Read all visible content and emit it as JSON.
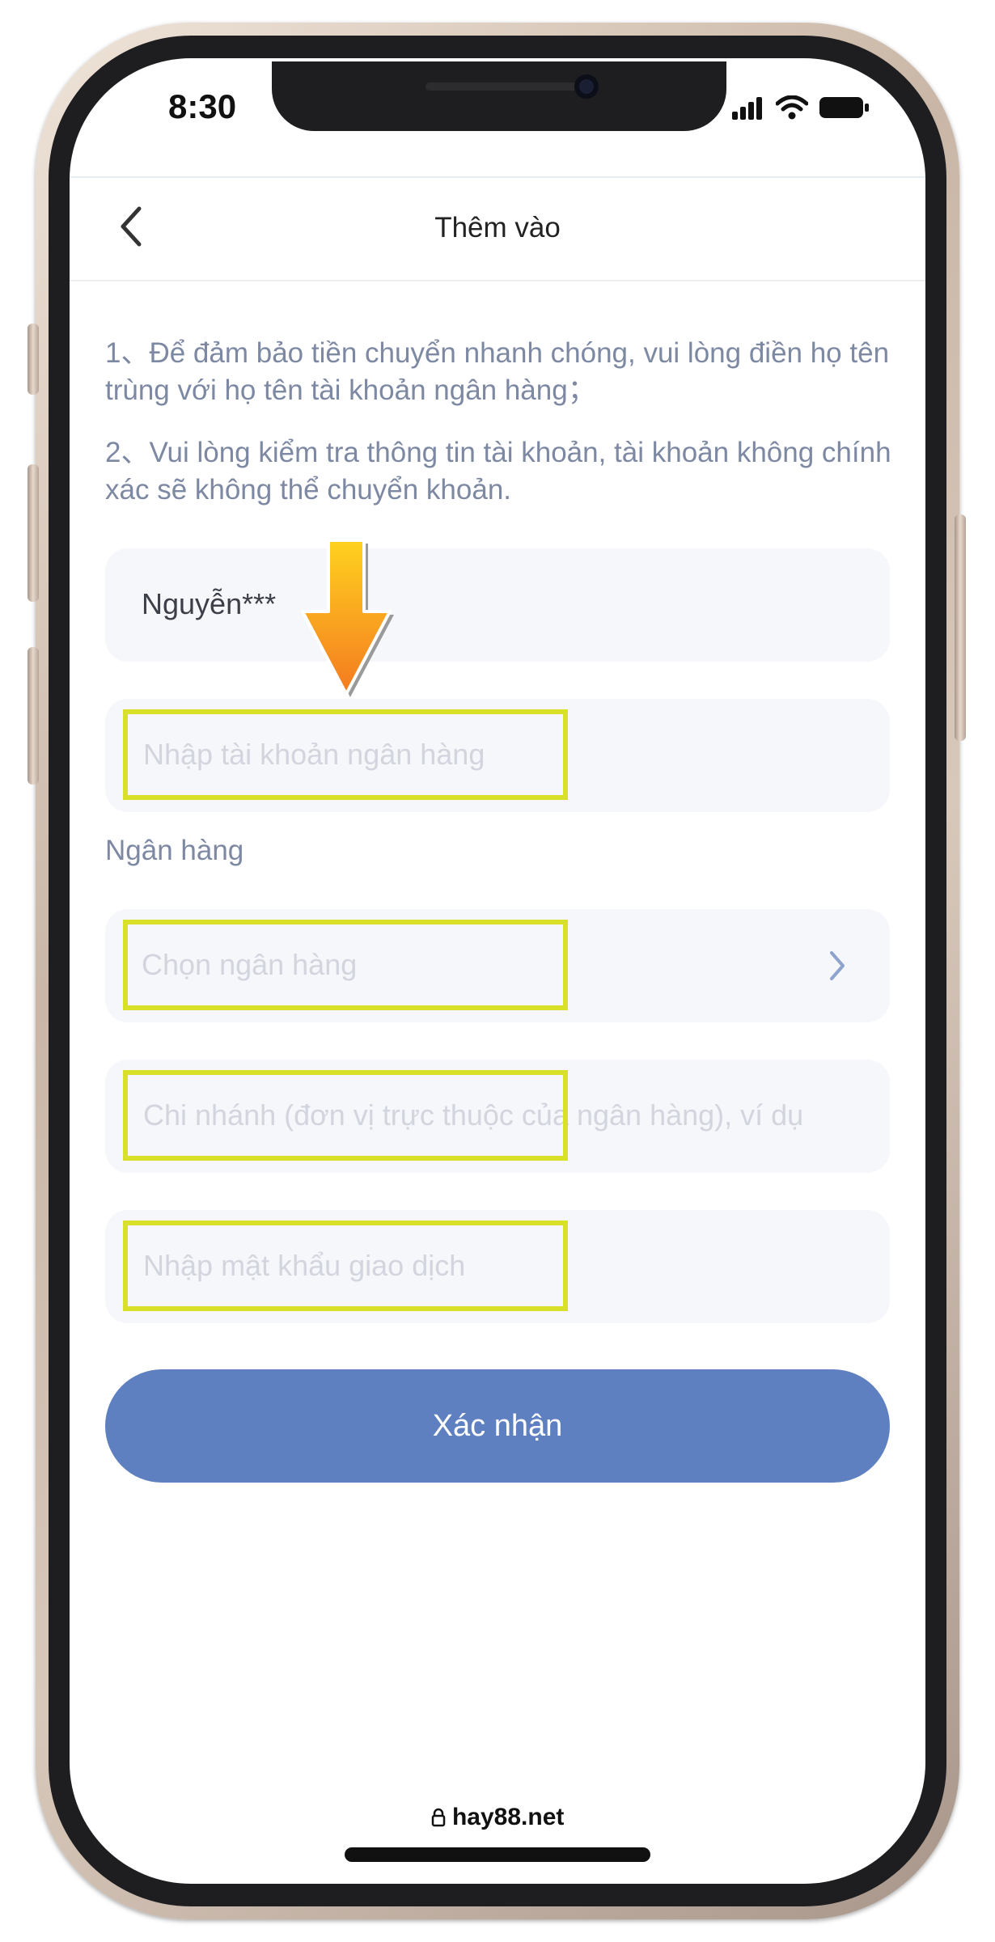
{
  "status_bar": {
    "time": "8:30"
  },
  "header": {
    "title": "Thêm vào"
  },
  "notices": [
    "1、Để đảm bảo tiền chuyển nhanh chóng, vui lòng điền họ tên trùng với họ tên tài khoản ngân hàng；",
    "2、Vui lòng kiểm tra thông tin tài khoản, tài khoản không chính xác sẽ không thể chuyển khoản."
  ],
  "form": {
    "name_value": "Nguyễn***",
    "account_placeholder": "Nhập tài khoản ngân hàng",
    "bank_section_label": "Ngân hàng",
    "bank_placeholder": "Chọn ngân hàng",
    "branch_placeholder": "Chi nhánh (đơn vị trực thuộc của ngân hàng), ví dụ",
    "password_placeholder": "Nhập mật khẩu giao dịch",
    "confirm_label": "Xác nhận"
  },
  "footer": {
    "url": "hay88.net"
  },
  "colors": {
    "accent": "#5e80c0",
    "highlight": "#d8e02a",
    "notice_text": "#7d88a3",
    "field_bg": "#f6f7fb"
  }
}
